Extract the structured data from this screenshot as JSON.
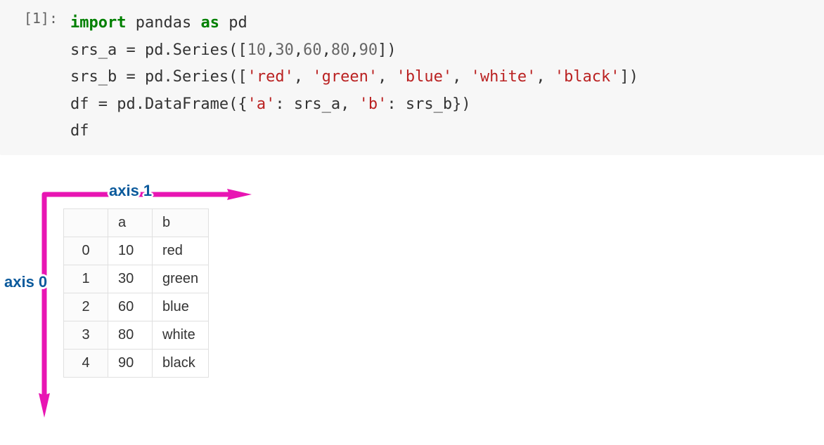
{
  "prompt": "[1]:",
  "code": {
    "line1": {
      "kw1": "import",
      "mod": "pandas",
      "kw2": "as",
      "alias": "pd"
    },
    "line2_pre": "srs_a = pd.Series([",
    "line2_nums": [
      "10",
      "30",
      "60",
      "80",
      "90"
    ],
    "line2_post": "])",
    "line3_pre": "srs_b = pd.Series([",
    "line3_strs": [
      "'red'",
      "'green'",
      "'blue'",
      "'white'",
      "'black'"
    ],
    "line3_post": "])",
    "line4_pre": "df = pd.DataFrame({",
    "line4_key_a": "'a'",
    "line4_mid1": ": srs_a, ",
    "line4_key_b": "'b'",
    "line4_mid2": ": srs_b})",
    "line5": "df"
  },
  "axis_labels": {
    "axis0": "axis 0",
    "axis1": "axis 1"
  },
  "table": {
    "columns": [
      "a",
      "b"
    ],
    "index": [
      "0",
      "1",
      "2",
      "3",
      "4"
    ],
    "rows": [
      [
        "10",
        "red"
      ],
      [
        "30",
        "green"
      ],
      [
        "60",
        "blue"
      ],
      [
        "80",
        "white"
      ],
      [
        "90",
        "black"
      ]
    ]
  },
  "chart_data": {
    "type": "table",
    "title": "pandas DataFrame",
    "columns": [
      "a",
      "b"
    ],
    "index": [
      0,
      1,
      2,
      3,
      4
    ],
    "series": [
      {
        "name": "a",
        "values": [
          10,
          30,
          60,
          80,
          90
        ]
      },
      {
        "name": "b",
        "values": [
          "red",
          "green",
          "blue",
          "white",
          "black"
        ]
      }
    ]
  },
  "colors": {
    "arrow": "#e815b3",
    "axis_text": "#0b5a9c"
  }
}
